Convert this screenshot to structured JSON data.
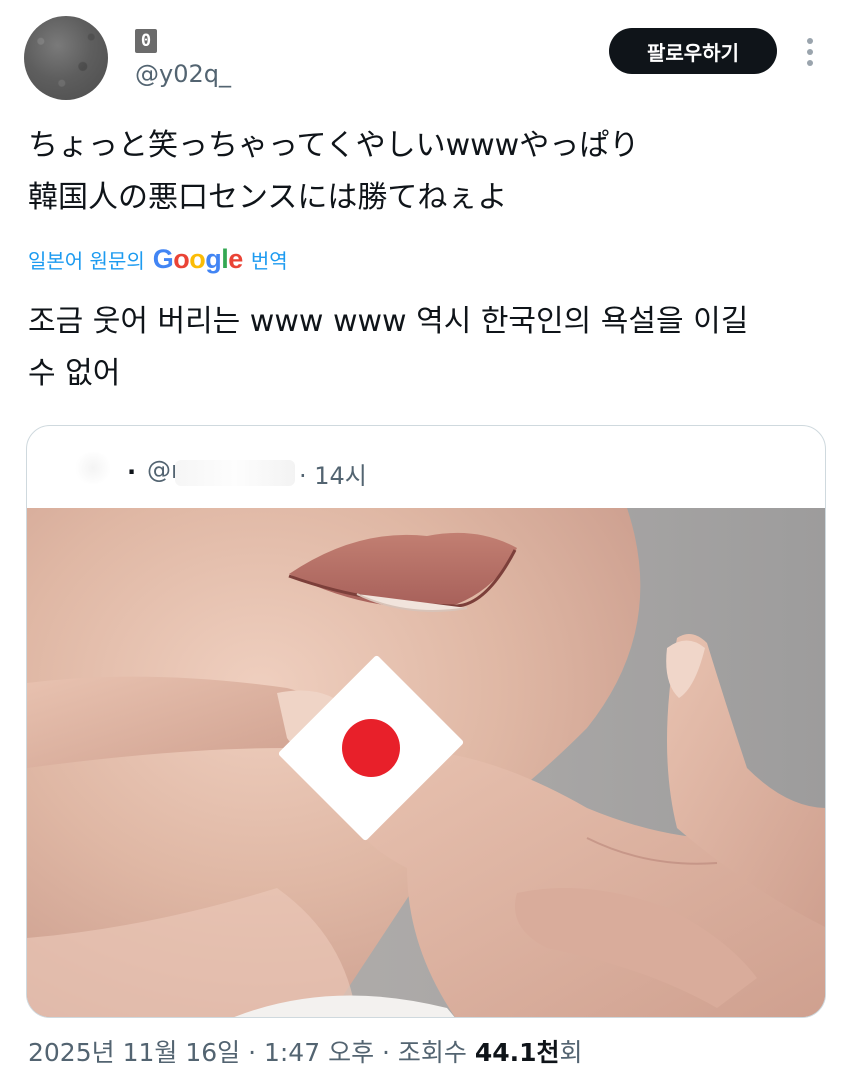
{
  "author": {
    "display_name": "0",
    "handle": "@y02q_",
    "follow_label": "팔로우하기"
  },
  "tweet": {
    "lines": [
      "ちょっと笑っちゃってくやしいwwwやっぱり",
      "韓国人の悪口センスには勝てねぇよ"
    ],
    "translate_label": "일본어 원문의",
    "translate_brand": "Google",
    "translate_action": "번역",
    "translated_lines": [
      "조금 웃어 버리는 www www 역시 한국인의 욕설을 이길",
      "수 없어"
    ]
  },
  "quote": {
    "dot": ".",
    "handle_prefix": "@r",
    "time": "· 14시"
  },
  "footer": {
    "date_time": "2025년 11월 16일 · 1:47 오후 · 조회수 ",
    "views": "44.1천",
    "views_suffix": "회"
  },
  "colors": {
    "link": "#1d9bf0",
    "secondary_text": "#536471",
    "flag_red": "#e8202a"
  }
}
